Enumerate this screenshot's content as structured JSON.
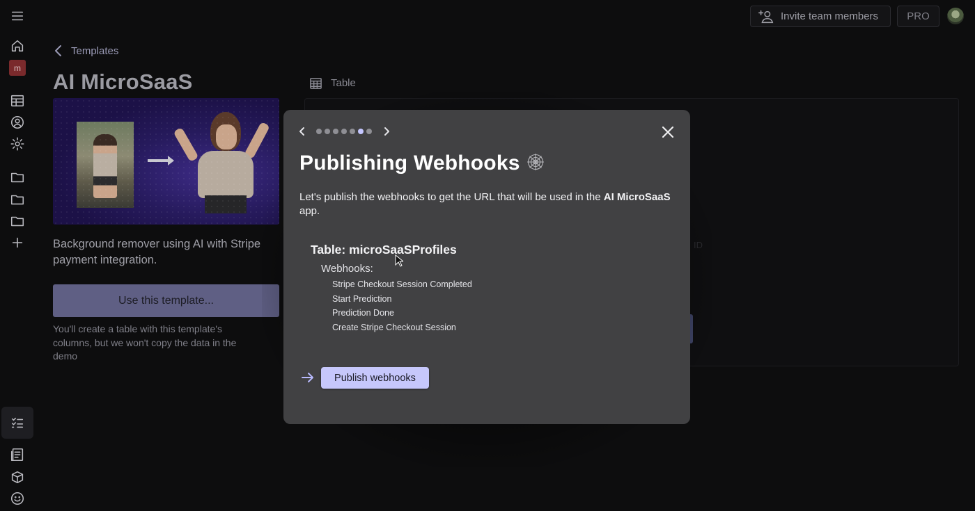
{
  "header": {
    "invite_label": "Invite team members",
    "pro_label": "PRO"
  },
  "sidebar": {
    "workspace_badge": "m",
    "icons": [
      "menu-icon",
      "home-icon",
      "workspace-badge",
      "tables-icon",
      "profile-icon",
      "settings-icon",
      "folder-icon",
      "folder-icon",
      "folder-icon",
      "plus-icon",
      "checklist-icon",
      "docs-icon",
      "package-icon",
      "smiley-icon"
    ]
  },
  "template": {
    "breadcrumb": "Templates",
    "title": "AI MicroSaaS",
    "description": "Background remover using AI with Stripe payment integration.",
    "use_button": "Use this template...",
    "note": "You'll create a table with this template's columns, but we won't copy the data in the demo"
  },
  "preview": {
    "tab_label": "Table",
    "faded_text": "ID"
  },
  "modal": {
    "title": "Publishing Webhooks",
    "intro_text": "Let's publish the webhooks to get the URL that will be used in the ",
    "intro_bold": "AI MicroSaaS",
    "intro_tail": " app.",
    "table_name": "Table: microSaaSProfiles",
    "webhooks_label": "Webhooks:",
    "webhooks": [
      "Stripe Checkout Session Completed",
      "Start Prediction",
      "Prediction Done",
      "Create Stripe Checkout Session"
    ],
    "publish_button": "Publish webhooks",
    "steps_total": 7,
    "step_current": 6
  },
  "colors": {
    "modal_bg": "#414143",
    "accent": "#c6c7fb",
    "page_bg": "#0d0d0e"
  }
}
